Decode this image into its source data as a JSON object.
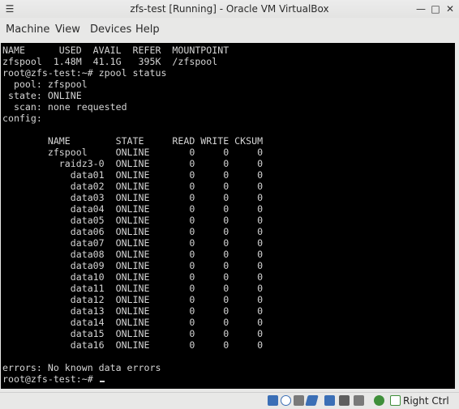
{
  "window": {
    "title": "zfs-test [Running] - Oracle VM VirtualBox",
    "menu_glyph": "☰",
    "minimize_glyph": "—",
    "maximize_glyph": "□",
    "close_glyph": "✕"
  },
  "menu": [
    "Machine",
    "View",
    "Devices",
    "Help"
  ],
  "terminal": {
    "lines": [
      "NAME      USED  AVAIL  REFER  MOUNTPOINT",
      "zfspool  1.48M  41.1G   395K  /zfspool",
      "root@zfs-test:~# zpool status",
      "  pool: zfspool",
      " state: ONLINE",
      "  scan: none requested",
      "config:",
      "",
      "        NAME        STATE     READ WRITE CKSUM",
      "        zfspool     ONLINE       0     0     0",
      "          raidz3-0  ONLINE       0     0     0",
      "            data01  ONLINE       0     0     0",
      "            data02  ONLINE       0     0     0",
      "            data03  ONLINE       0     0     0",
      "            data04  ONLINE       0     0     0",
      "            data05  ONLINE       0     0     0",
      "            data06  ONLINE       0     0     0",
      "            data07  ONLINE       0     0     0",
      "            data08  ONLINE       0     0     0",
      "            data09  ONLINE       0     0     0",
      "            data10  ONLINE       0     0     0",
      "            data11  ONLINE       0     0     0",
      "            data12  ONLINE       0     0     0",
      "            data13  ONLINE       0     0     0",
      "            data14  ONLINE       0     0     0",
      "            data15  ONLINE       0     0     0",
      "            data16  ONLINE       0     0     0",
      "",
      "errors: No known data errors",
      "root@zfs-test:~# "
    ]
  },
  "statusbar": {
    "icons": [
      "hard-disk-icon",
      "optical-drive-icon",
      "usb-icon",
      "shared-folder-icon",
      "display-icon",
      "video-capture-icon",
      "network-icon",
      "mouse-integration-icon",
      "keyboard-capture-icon"
    ],
    "host_key": "Right Ctrl",
    "colors": {
      "blue": "#3b6fb6",
      "green": "#3f8f3a",
      "gray": "#7a7a7a"
    }
  }
}
